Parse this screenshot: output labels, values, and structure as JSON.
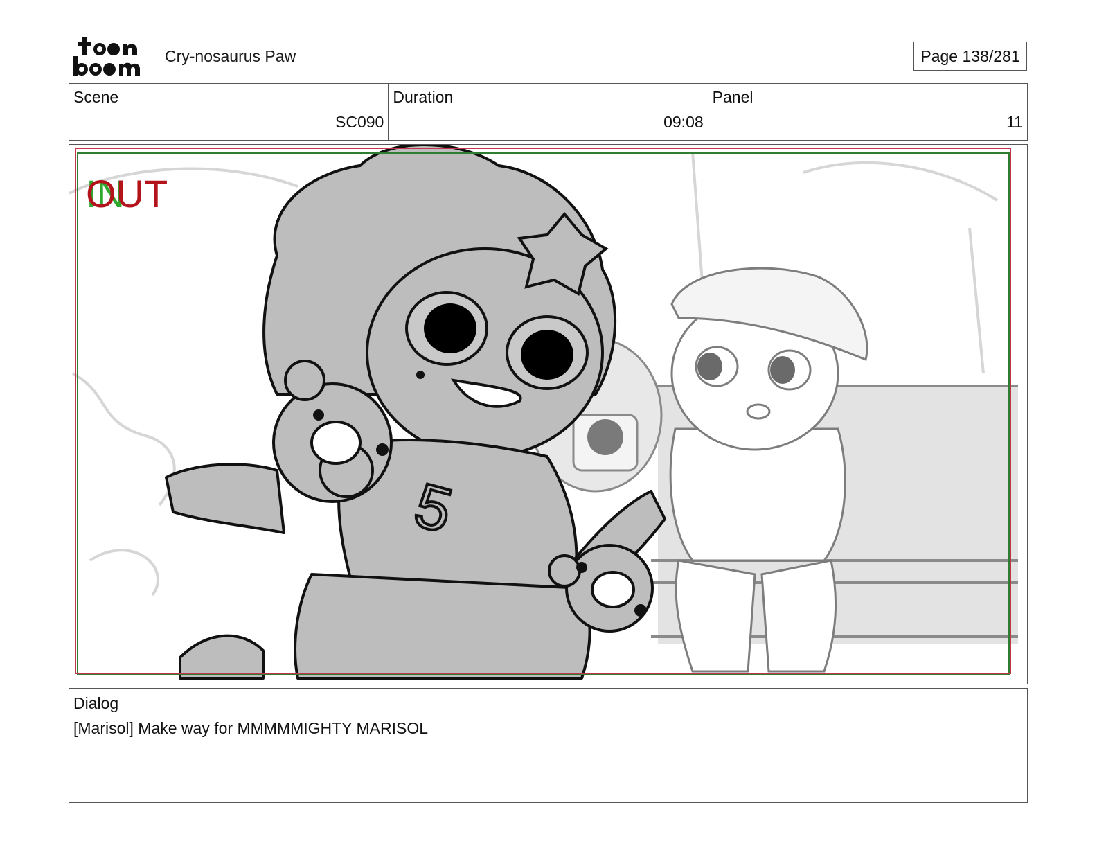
{
  "header": {
    "logo_text": "toon boom",
    "project_title": "Cry-nosaurus Paw",
    "page_label": "Page 138/281"
  },
  "info": {
    "scene_label": "Scene",
    "scene_value": "SC090",
    "duration_label": "Duration",
    "duration_value": "09:08",
    "panel_label": "Panel",
    "panel_value": "11"
  },
  "panel": {
    "in_marker": "IN",
    "out_marker": "OUT",
    "colors": {
      "out_red": "#b3141b",
      "in_green": "#2fa82f",
      "safe_frame_green": "#2e7d32",
      "camera_frame_red": "#c0364a",
      "character_fill": "#bdbdbd",
      "background_fill": "#e3e3e3"
    }
  },
  "dialog": {
    "label": "Dialog",
    "text": "[Marisol] Make way for MMMMMIGHTY MARISOL"
  }
}
